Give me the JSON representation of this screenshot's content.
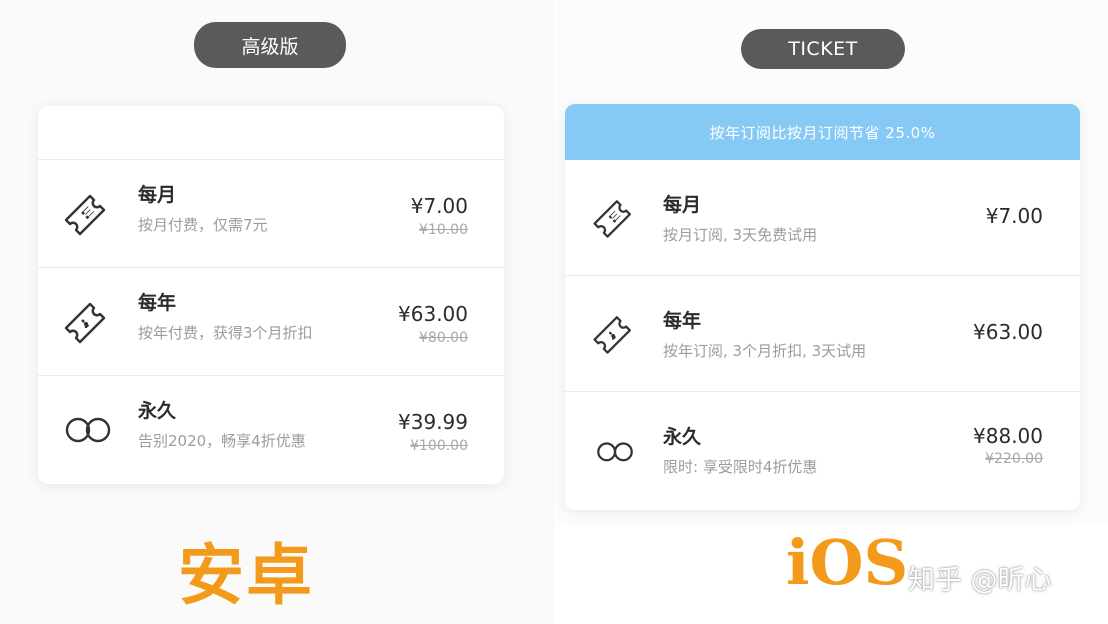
{
  "android": {
    "pill": "高级版",
    "plans": [
      {
        "title": "每月",
        "desc": "按月付费，仅需7元",
        "price": "¥7.00",
        "old_price": "¥10.00",
        "icon": "ticket-icon"
      },
      {
        "title": "每年",
        "desc": "按年付费，获得3个月折扣",
        "price": "¥63.00",
        "old_price": "¥80.00",
        "icon": "ticket-icon"
      },
      {
        "title": "永久",
        "desc": "告别2020，畅享4折优惠",
        "price": "¥39.99",
        "old_price": "¥100.00",
        "icon": "infinity-icon"
      }
    ],
    "platform_label": "安卓"
  },
  "ios": {
    "pill": "TICKET",
    "banner": "按年订阅比按月订阅节省 25.0%",
    "plans": [
      {
        "title": "每月",
        "desc": "按月订阅, 3天免费试用",
        "price": "¥7.00",
        "icon": "ticket-icon"
      },
      {
        "title": "每年",
        "desc": "按年订阅, 3个月折扣, 3天试用",
        "price": "¥63.00",
        "icon": "ticket-icon"
      },
      {
        "title": "永久",
        "desc": "限时: 享受限时4折优惠",
        "price": "¥88.00",
        "old_price": "¥220.00",
        "icon": "infinity-icon"
      }
    ],
    "platform_label": "iOS"
  },
  "watermark": "知乎 @昕心"
}
